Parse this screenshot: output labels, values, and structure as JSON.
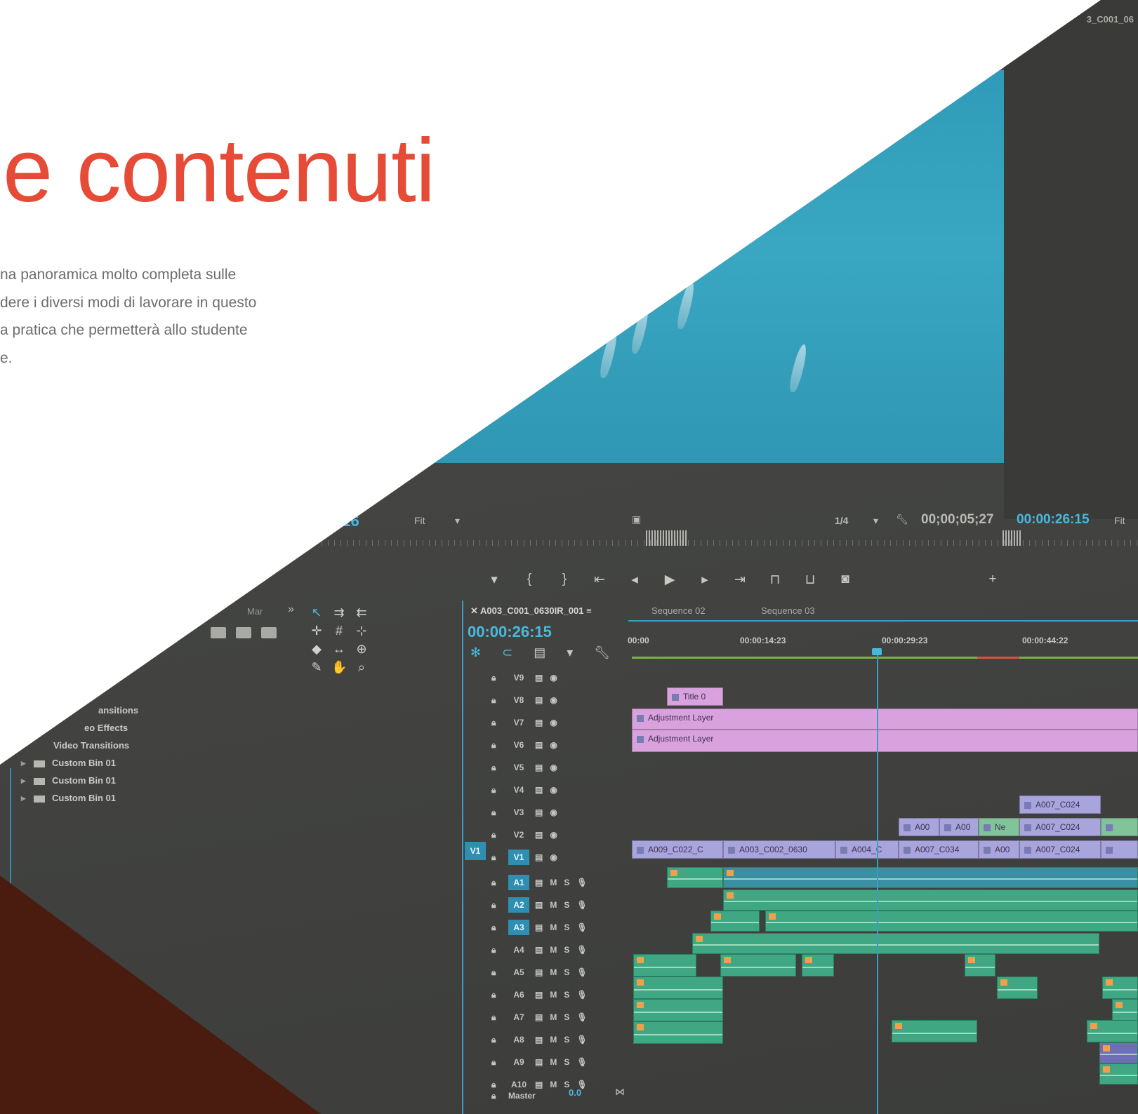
{
  "hero": {
    "title": "e contenuti",
    "paragraph": [
      "na panoramica molto completa sulle",
      "dere i diversi modi di lavorare in questo",
      "a pratica che permetterà allo studente",
      "e."
    ]
  },
  "editor": {
    "source_viewer": {
      "timecode": ";16",
      "fit": "Fit"
    },
    "program_viewer": {
      "resolution": "1/4",
      "duration_timecode": "00;00;05;27",
      "current_timecode": "00:00:26:15",
      "fit": "Fit",
      "clip_name_corner": "3_C001_06"
    },
    "project_panel": {
      "tab_partial": "Mar",
      "items": [
        {
          "label": "ansitions",
          "type": "text"
        },
        {
          "label": "eo Effects",
          "type": "text"
        },
        {
          "label": "Video Transitions",
          "type": "text"
        },
        {
          "label": "Custom Bin 01",
          "type": "bin"
        },
        {
          "label": "Custom Bin 01",
          "type": "bin"
        },
        {
          "label": "Custom Bin 01",
          "type": "bin"
        }
      ]
    },
    "timeline": {
      "tabs": {
        "active": "A003_C001_0630IR_001",
        "seq2": "Sequence 02",
        "seq3": "Sequence 03"
      },
      "timecode": "00:00:26:15",
      "ruler": [
        "00:00",
        "00:00:14:23",
        "00:00:29:23",
        "00:00:44:22"
      ],
      "source_patch": "V1",
      "master_label": "Master",
      "master_volume": "0.0",
      "clips": {
        "title": "Title 0",
        "adjustment_1": "Adjustment Layer",
        "adjustment_2": "Adjustment Layer",
        "v3_a": "A007_C024",
        "v2_a": "A00",
        "v2_b": "A00",
        "v2_c": "Ne",
        "v2_d": "A007_C024",
        "v1_a": "A009_C022_C",
        "v1_b": "A003_C002_0630",
        "v1_c": "A004_C",
        "v1_d": "A007_C034",
        "v1_e": "A00",
        "v1_f": "A007_C024"
      }
    }
  }
}
